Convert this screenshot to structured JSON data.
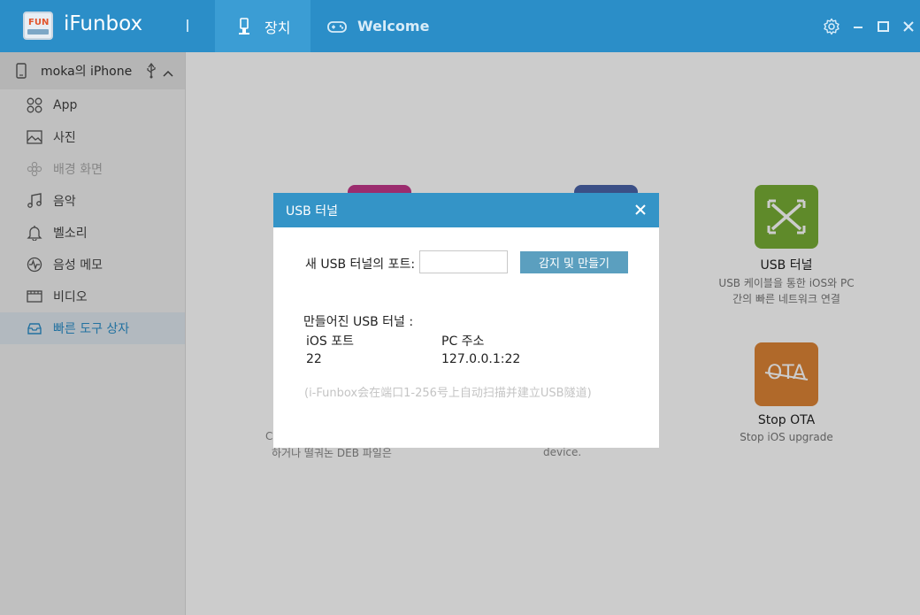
{
  "app": {
    "title": "iFunbox",
    "logo_text": "FUN"
  },
  "tabs": [
    {
      "label": "장치",
      "icon": "usb-drive-icon",
      "active": true
    },
    {
      "label": "Welcome",
      "icon": "gamepad-icon",
      "active": false
    }
  ],
  "sidebar": {
    "device_name": "moka의 iPhone",
    "items": [
      {
        "label": "App",
        "icon": "apps-grid-icon"
      },
      {
        "label": "사진",
        "icon": "photo-icon"
      },
      {
        "label": "배경 화면",
        "icon": "wallpaper-icon",
        "disabled": true
      },
      {
        "label": "음악",
        "icon": "music-icon"
      },
      {
        "label": "벨소리",
        "icon": "bell-icon"
      },
      {
        "label": "음성 메모",
        "icon": "voice-memo-icon"
      },
      {
        "label": "비디오",
        "icon": "video-icon"
      },
      {
        "label": "빠른 도구 상자",
        "icon": "toolbox-icon",
        "active": true
      }
    ]
  },
  "tools": {
    "usb_tunnel": {
      "name": "USB 터널",
      "desc1": "USB 케이블을 통한 iOS와 PC",
      "desc2": "간의 빠른 네트워크 연결",
      "color": "#77ad35"
    },
    "stop_ota": {
      "name": "Stop OTA",
      "desc": "Stop iOS upgrade",
      "tile_text": "OTA",
      "color": "#dd8435"
    },
    "left_tool": {
      "color": "#c2388a",
      "frag1": "C",
      "frag2": "하거나 떨궈논 DEB 파일은"
    },
    "middle_tool": {
      "color": "#4a63a8",
      "frag": "device."
    }
  },
  "dialog": {
    "title": "USB 터널",
    "port_label": "새 USB 터널의 포트:",
    "port_value": "",
    "create_button": "감지 및 만들기",
    "made_label": "만들어진 USB 터널 :",
    "col_ios": "iOS 포트",
    "col_pc": "PC 주소",
    "row_ios": "22",
    "row_pc": "127.0.0.1:22",
    "hint": "(i-Funbox会在端口1-256号上自动扫描并建立USB隧道)"
  },
  "colors": {
    "titlebar": "#2b8ec8",
    "accent": "#2b8ec8",
    "dialog_header": "#3494c7"
  }
}
